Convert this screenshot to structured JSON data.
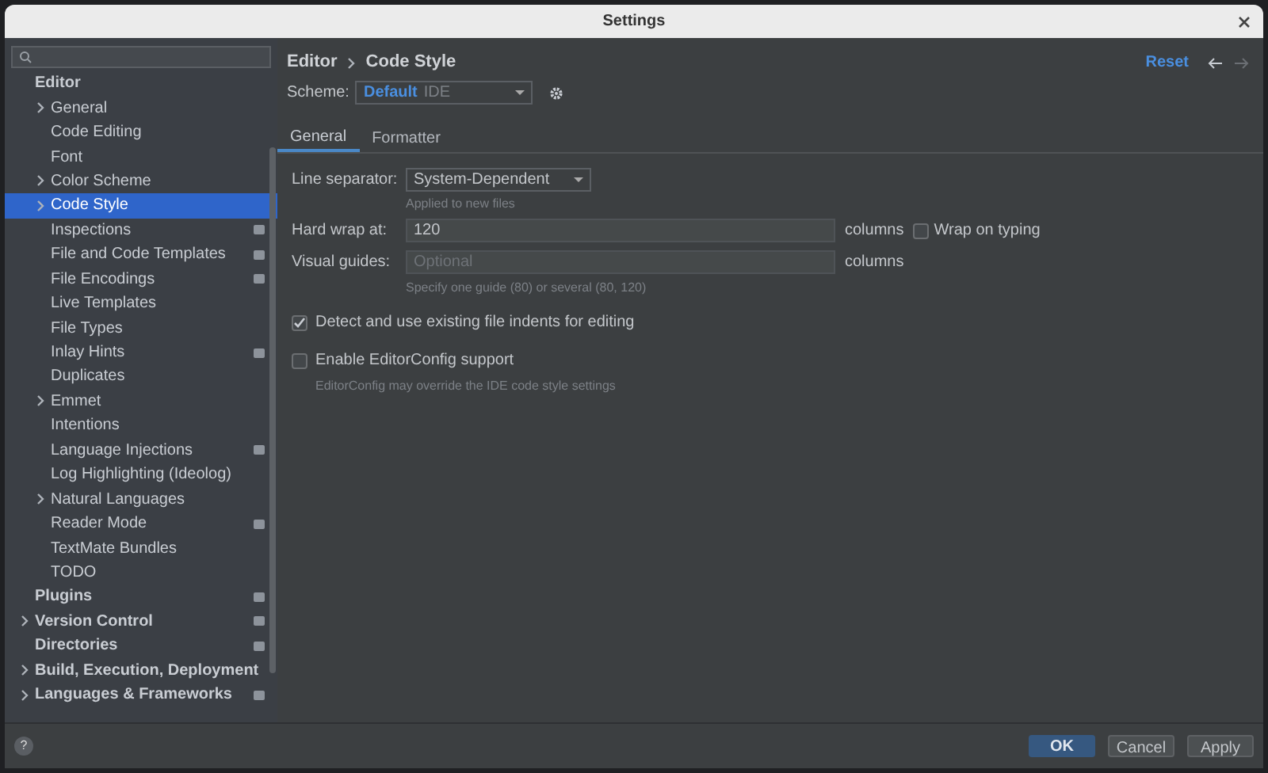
{
  "window": {
    "title": "Settings"
  },
  "sidebar": {
    "items": [
      {
        "label": "Editor",
        "selected": false,
        "children": [
          {
            "label": "General",
            "expanded": false,
            "selected": false,
            "marked": false
          },
          {
            "label": "Code Editing",
            "selected": false,
            "marked": false
          },
          {
            "label": "Font",
            "selected": false,
            "marked": false
          },
          {
            "label": "Color Scheme",
            "expanded": false,
            "selected": false,
            "marked": false
          },
          {
            "label": "Code Style",
            "expanded": false,
            "selected": true,
            "marked": false
          },
          {
            "label": "Inspections",
            "selected": false,
            "marked": true
          },
          {
            "label": "File and Code Templates",
            "selected": false,
            "marked": true
          },
          {
            "label": "File Encodings",
            "selected": false,
            "marked": true
          },
          {
            "label": "Live Templates",
            "selected": false,
            "marked": false
          },
          {
            "label": "File Types",
            "selected": false,
            "marked": false
          },
          {
            "label": "Inlay Hints",
            "selected": false,
            "marked": true
          },
          {
            "label": "Duplicates",
            "selected": false,
            "marked": false
          },
          {
            "label": "Emmet",
            "expanded": false,
            "selected": false,
            "marked": false
          },
          {
            "label": "Intentions",
            "selected": false,
            "marked": false
          },
          {
            "label": "Language Injections",
            "selected": false,
            "marked": true
          },
          {
            "label": "Log Highlighting (Ideolog)",
            "selected": false,
            "marked": false
          },
          {
            "label": "Natural Languages",
            "expanded": false,
            "selected": false,
            "marked": false
          },
          {
            "label": "Reader Mode",
            "selected": false,
            "marked": true
          },
          {
            "label": "TextMate Bundles",
            "selected": false,
            "marked": false
          },
          {
            "label": "TODO",
            "selected": false,
            "marked": false
          }
        ]
      },
      {
        "label": "Plugins",
        "selected": false,
        "marked": true
      },
      {
        "label": "Version Control",
        "expanded": false,
        "selected": false,
        "marked": true
      },
      {
        "label": "Directories",
        "selected": false,
        "marked": true
      },
      {
        "label": "Build, Execution, Deployment",
        "expanded": false,
        "selected": false,
        "marked": false
      },
      {
        "label": "Languages & Frameworks",
        "expanded": false,
        "selected": false,
        "marked": true
      }
    ]
  },
  "breadcrumb": [
    "Editor",
    "Code Style"
  ],
  "reset": "Reset",
  "scheme": {
    "label": "Scheme:",
    "name": "Default",
    "sub": "IDE"
  },
  "tabs": [
    {
      "label": "General",
      "selected": true
    },
    {
      "label": "Formatter",
      "selected": false
    }
  ],
  "line_separator": {
    "label": "Line separator:",
    "value": "System-Dependent",
    "hint": "Applied to new files"
  },
  "hard_wrap": {
    "label": "Hard wrap at:",
    "value": "120",
    "unit": "columns",
    "wrap_label": "Wrap on typing",
    "wrap_checked": false
  },
  "visual_guides": {
    "label": "Visual guides:",
    "placeholder": "Optional",
    "unit": "columns",
    "hint": "Specify one guide (80) or several (80, 120)"
  },
  "detect_indents": {
    "label": "Detect and use existing file indents for editing",
    "checked": true
  },
  "editorconfig": {
    "label": "Enable EditorConfig support",
    "checked": false,
    "hint": "EditorConfig may override the IDE code style settings"
  },
  "buttons": [
    {
      "label": "OK",
      "kind": "primary"
    },
    {
      "label": "Cancel",
      "kind": "secondary"
    },
    {
      "label": "Apply",
      "kind": "secondary"
    }
  ],
  "help": "?"
}
